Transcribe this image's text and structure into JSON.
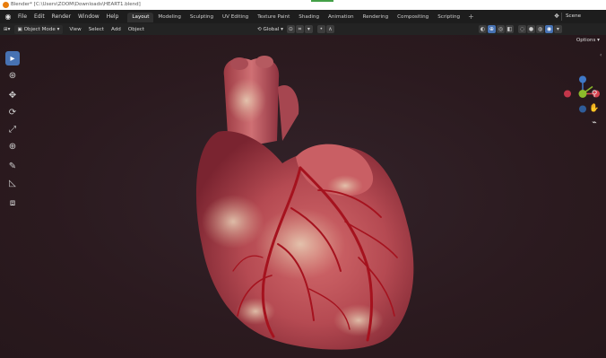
{
  "titlebar": {
    "title": "Blender* [C:\\Users\\ZOOM\\Downloads\\HEART1.blend]"
  },
  "menubar": {
    "menus": [
      "File",
      "Edit",
      "Render",
      "Window",
      "Help"
    ],
    "workspaces": [
      "Layout",
      "Modeling",
      "Sculpting",
      "UV Editing",
      "Texture Paint",
      "Shading",
      "Animation",
      "Rendering",
      "Compositing",
      "Scripting"
    ],
    "active_workspace": "Layout",
    "add_workspace": "+",
    "scene": "Scene"
  },
  "viewport_header": {
    "mode": "Object Mode",
    "menus": [
      "View",
      "Select",
      "Add",
      "Object"
    ],
    "orientation": "Global",
    "options": "Options"
  },
  "toolbar": {
    "tools": [
      "select-box-icon",
      "cursor-icon",
      "move-icon",
      "rotate-icon",
      "scale-icon",
      "transform-icon",
      "annotate-icon",
      "measure-icon",
      "add-cube-icon"
    ],
    "active_tool": "select-box-icon"
  },
  "gizmo": {
    "axes": {
      "x": "#d8424f",
      "y": "#8cba2b",
      "z": "#3f79c8"
    }
  },
  "colors": {
    "background": "#2b1a1e",
    "menubar": "#1d1d1d",
    "accent": "#4772b3",
    "heart": "#c8575c"
  }
}
